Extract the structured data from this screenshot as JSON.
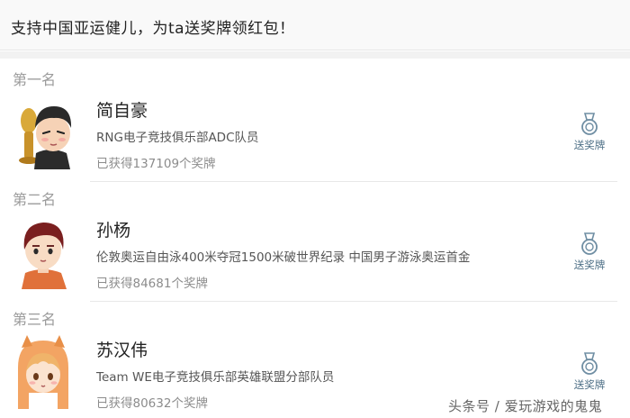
{
  "banner": {
    "text": "支持中国亚运健儿，为ta送奖牌领红包！"
  },
  "entries": [
    {
      "rank": "第一名",
      "name": "简自豪",
      "description": "RNG电子竞技俱乐部ADC队员",
      "medal_count": "已获得137109个奖牌",
      "button_label": "送奖牌",
      "avatar_icon": "cartoon-avatar-trophy-icon"
    },
    {
      "rank": "第二名",
      "name": "孙杨",
      "description": "伦敦奥运自由泳400米夺冠1500米破世界纪录 中国男子游泳奥运首金",
      "medal_count": "已获得84681个奖牌",
      "button_label": "送奖牌",
      "avatar_icon": "cartoon-avatar-swimmer-icon"
    },
    {
      "rank": "第三名",
      "name": "苏汉伟",
      "description": "Team WE电子竞技俱乐部英雄联盟分部队员",
      "medal_count": "已获得80632个奖牌",
      "button_label": "送奖牌",
      "avatar_icon": "cartoon-avatar-umaru-icon"
    }
  ],
  "watermark": "头条号 / 爱玩游戏的鬼鬼",
  "colors": {
    "accent": "#4d6f86",
    "rank_gray": "#9a9a9a"
  }
}
